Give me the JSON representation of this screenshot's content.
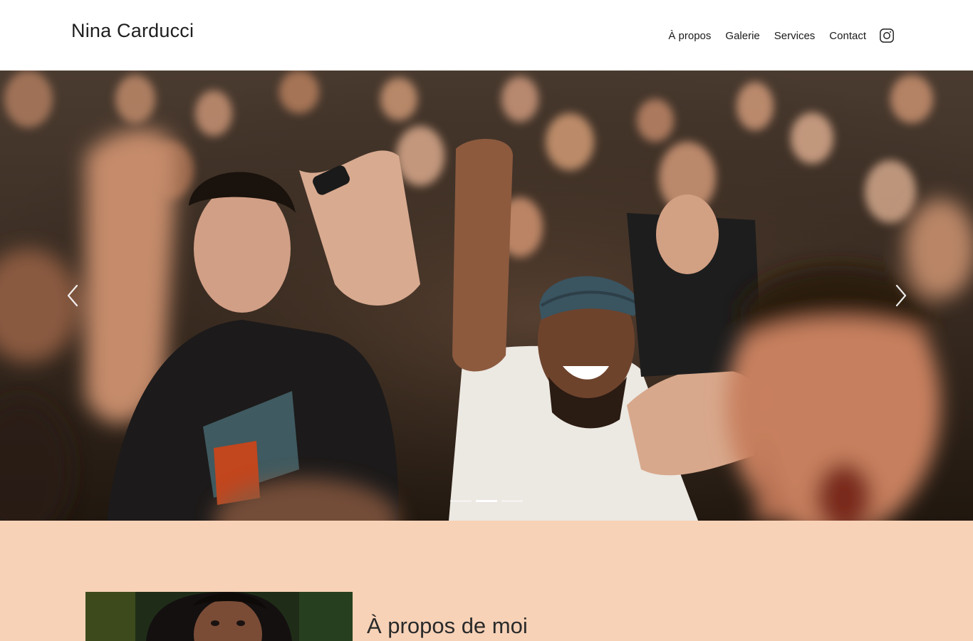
{
  "header": {
    "brand": "Nina Carducci",
    "nav": [
      "À propos",
      "Galerie",
      "Services",
      "Contact"
    ],
    "instagram_icon": "instagram-icon"
  },
  "hero": {
    "slide_count": 3,
    "active_slide": 2,
    "prev_icon": "chevron-left-icon",
    "next_icon": "chevron-right-icon",
    "colors": {
      "crowd_dark": "#2b2118",
      "shirt_white": "#ece8e2",
      "skin": "#c98c6b"
    }
  },
  "about": {
    "title": "À propos de moi",
    "background": "#f7d2b7"
  }
}
